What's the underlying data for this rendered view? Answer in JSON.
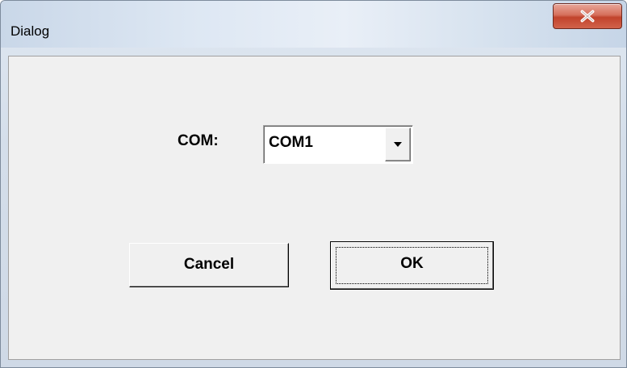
{
  "window": {
    "title": "Dialog",
    "close_icon": "close-icon"
  },
  "form": {
    "com_label": "COM:",
    "com_selected": "COM1",
    "dropdown_icon": "chevron-down-icon"
  },
  "buttons": {
    "cancel_label": "Cancel",
    "ok_label": "OK"
  },
  "colors": {
    "close_button": "#c9533d",
    "dialog_background": "#f0f0f0"
  }
}
